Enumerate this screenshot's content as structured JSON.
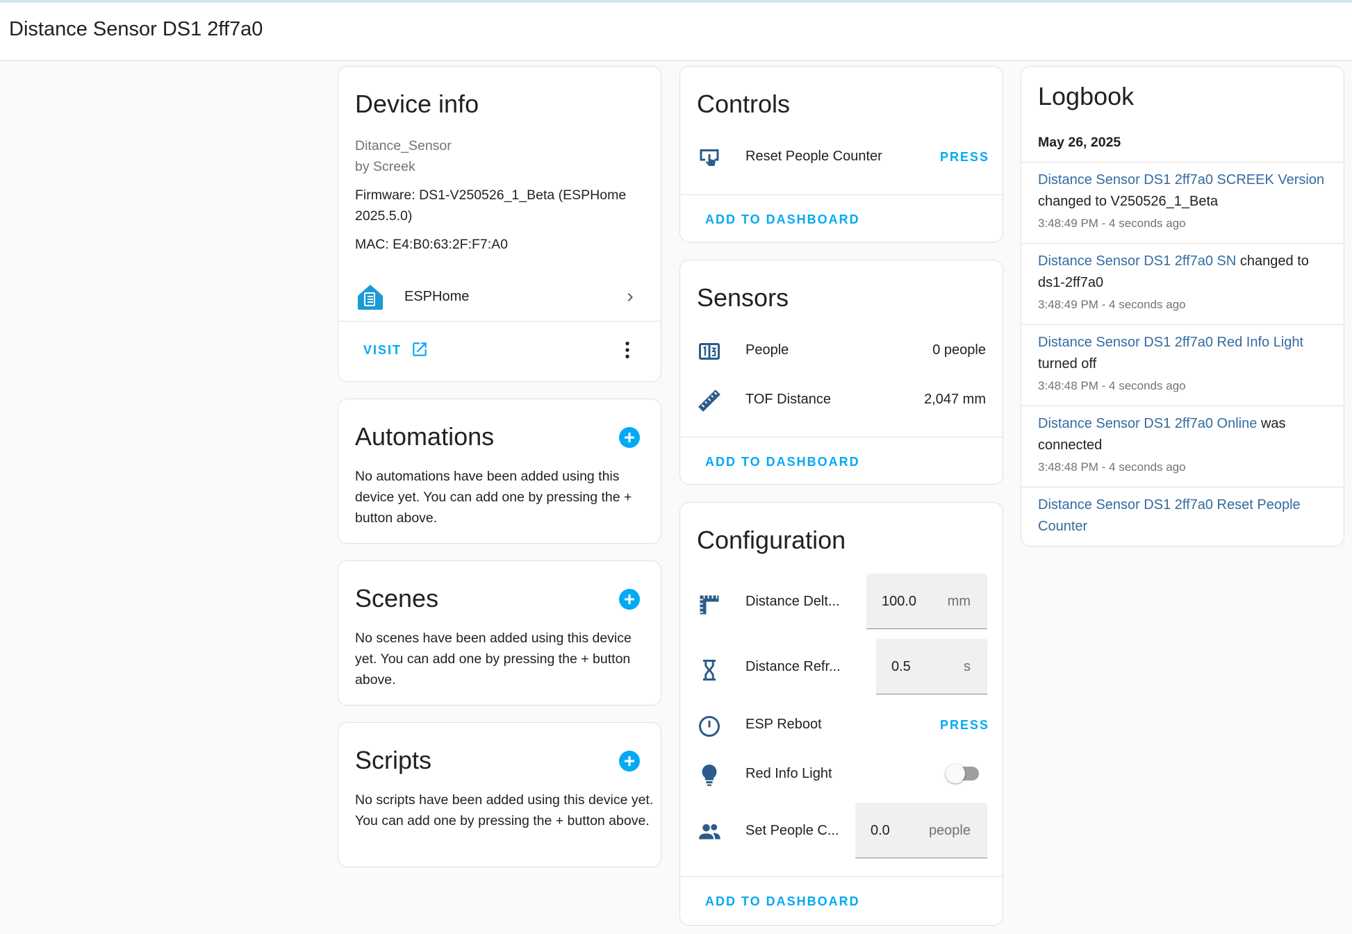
{
  "page": {
    "title": "Distance Sensor DS1 2ff7a0"
  },
  "colors": {
    "accent": "#03a9f4",
    "link": "#346b9f",
    "icon": "#2c5c8a",
    "muted": "#727272"
  },
  "device_info": {
    "title": "Device info",
    "model": "Ditance_Sensor",
    "manufacturer": "by Screek",
    "firmware_line1": "Firmware: DS1-V250526_1_Beta (ESPHome",
    "firmware_line2": "2025.5.0)",
    "mac": "MAC: E4:B0:63:2F:F7:A0",
    "integration": {
      "label": "ESPHome",
      "icon": "esphome-icon"
    },
    "visit_label": "VISIT"
  },
  "automations": {
    "title": "Automations",
    "empty_text": "No automations have been added using this device yet. You can add one by pressing the + button above."
  },
  "scenes": {
    "title": "Scenes",
    "empty_text": "No scenes have been added using this device yet. You can add one by pressing the + button above."
  },
  "scripts": {
    "title": "Scripts",
    "empty_text": "No scripts have been added using this device yet. You can add one by pressing the + button above."
  },
  "controls": {
    "title": "Controls",
    "items": [
      {
        "name": "Reset People Counter",
        "action": "PRESS",
        "icon": "gesture-tap-button-icon"
      }
    ],
    "add_to_dashboard": "ADD TO DASHBOARD"
  },
  "sensors": {
    "title": "Sensors",
    "items": [
      {
        "name": "People",
        "value": "0 people",
        "icon": "counter-icon"
      },
      {
        "name": "TOF Distance",
        "value": "2,047 mm",
        "icon": "ruler-icon"
      }
    ],
    "add_to_dashboard": "ADD TO DASHBOARD"
  },
  "configuration": {
    "title": "Configuration",
    "items": [
      {
        "name": "Distance Delt...",
        "value": "100.0",
        "unit": "mm",
        "icon": "ruler-square-icon"
      },
      {
        "name": "Distance Refr...",
        "value": "0.5",
        "unit": "s",
        "icon": "timer-sand-icon"
      },
      {
        "name": "ESP Reboot",
        "action": "PRESS",
        "icon": "restart-icon"
      },
      {
        "name": "Red Info Light",
        "state": "off",
        "icon": "lightbulb-icon"
      },
      {
        "name": "Set People C...",
        "value": "0.0",
        "unit": "people",
        "icon": "account-group-icon"
      }
    ],
    "add_to_dashboard": "ADD TO DASHBOARD"
  },
  "logbook": {
    "title": "Logbook",
    "date": "May 26, 2025",
    "entries": [
      {
        "entity": "Distance Sensor DS1 2ff7a0 SCREEK Version",
        "message": "changed to V250526_1_Beta",
        "time": "3:48:49 PM - 4 seconds ago"
      },
      {
        "entity": "Distance Sensor DS1 2ff7a0 SN",
        "message": "changed to ds1-2ff7a0",
        "time": "3:48:49 PM - 4 seconds ago"
      },
      {
        "entity": "Distance Sensor DS1 2ff7a0 Red Info Light",
        "message": "turned off",
        "time": "3:48:48 PM - 4 seconds ago"
      },
      {
        "entity": "Distance Sensor DS1 2ff7a0 Online",
        "message": "was connected",
        "time": "3:48:48 PM - 4 seconds ago"
      },
      {
        "entity": "Distance Sensor DS1 2ff7a0 Reset People Counter",
        "message": "",
        "time": ""
      }
    ]
  }
}
